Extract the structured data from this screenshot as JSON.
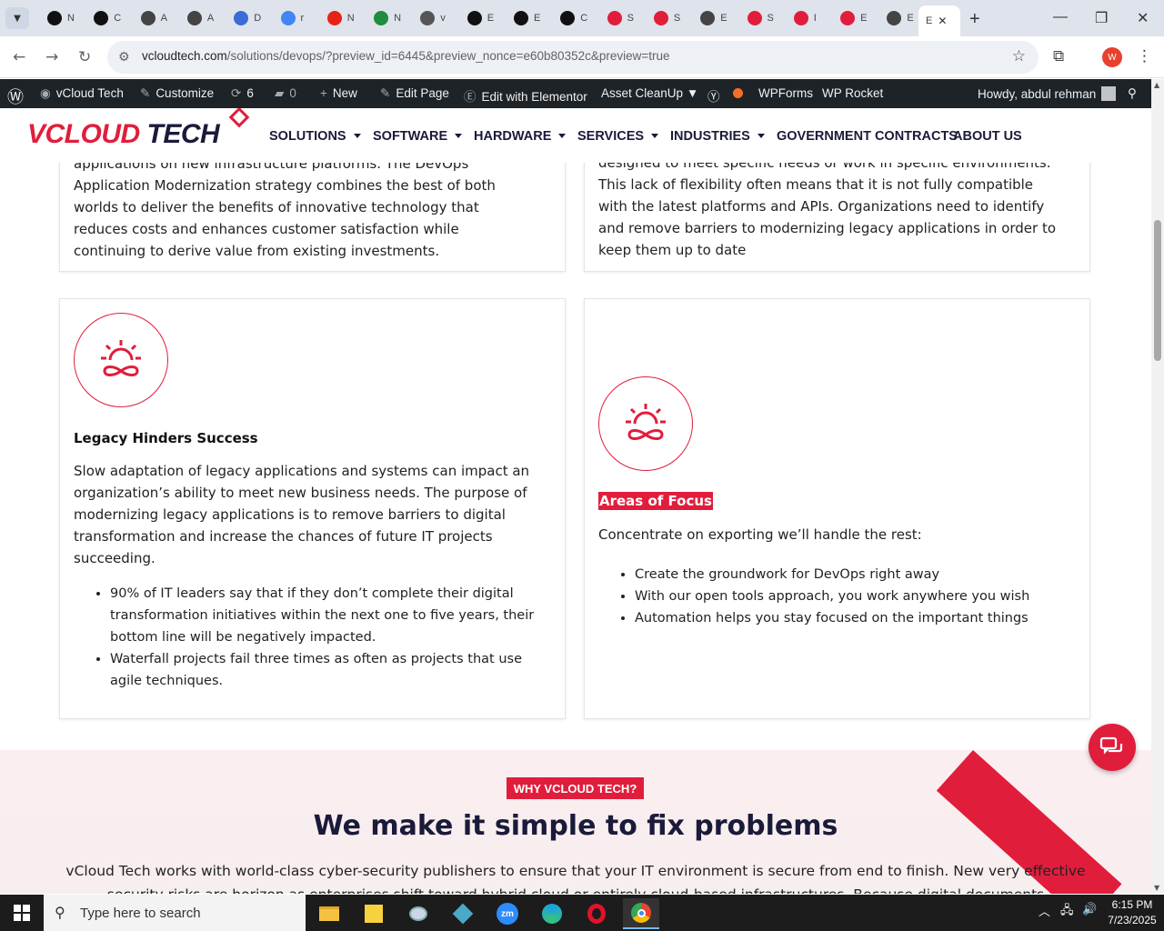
{
  "browser": {
    "tabs": [
      {
        "label": "N",
        "icon": "openai-icon",
        "color": "#111111"
      },
      {
        "label": "C",
        "icon": "openai-icon",
        "color": "#111111"
      },
      {
        "label": "A",
        "icon": "openai-icon",
        "color": "#444444"
      },
      {
        "label": "A",
        "icon": "openai-icon",
        "color": "#444444"
      },
      {
        "label": "D",
        "icon": "dev-icon",
        "color": "#3b6bd6"
      },
      {
        "label": "r",
        "icon": "google-icon",
        "color": "#4285f4"
      },
      {
        "label": "N",
        "icon": "youtube-icon",
        "color": "#e62117"
      },
      {
        "label": "N",
        "icon": "w-icon",
        "color": "#1e8e3e"
      },
      {
        "label": "v",
        "icon": "linkedin-icon",
        "color": "#555555"
      },
      {
        "label": "E",
        "icon": "x-icon",
        "color": "#111111"
      },
      {
        "label": "E",
        "icon": "x-icon",
        "color": "#111111"
      },
      {
        "label": "C",
        "icon": "capcut-icon",
        "color": "#111111"
      },
      {
        "label": "S",
        "icon": "vcloud-icon",
        "color": "#e11d3c"
      },
      {
        "label": "S",
        "icon": "vcloud-icon",
        "color": "#e11d3c"
      },
      {
        "label": "E",
        "icon": "globe-icon",
        "color": "#444444"
      },
      {
        "label": "S",
        "icon": "vcloud-icon",
        "color": "#e11d3c"
      },
      {
        "label": "I",
        "icon": "vcloud-icon",
        "color": "#e11d3c"
      },
      {
        "label": "E",
        "icon": "vcloud-icon",
        "color": "#e11d3c"
      },
      {
        "label": "E",
        "icon": "globe-icon",
        "color": "#444444"
      }
    ],
    "active_tab": {
      "label": "E"
    },
    "url_host": "vcloudtech.com",
    "url_path": "/solutions/devops/?preview_id=6445&preview_nonce=e60b80352c&preview=true",
    "profile_initial": "W"
  },
  "adminbar": {
    "site": "vCloud Tech",
    "customize": "Customize",
    "updates": "6",
    "comments": "0",
    "new": "New",
    "edit_page": "Edit Page",
    "elementor": "Edit with Elementor",
    "asset_cleanup": "Asset CleanUp",
    "wpforms": "WPForms",
    "wprocket": "WP Rocket",
    "howdy": "Howdy, abdul rehman"
  },
  "site": {
    "logo_v": "V",
    "logo_cloud": "CLOUD",
    "logo_tech": " TECH",
    "menu": [
      "SOLUTIONS",
      "SOFTWARE",
      "HARDWARE",
      "SERVICES",
      "INDUSTRIES",
      "GOVERNMENT CONTRACTS",
      "ABOUT US"
    ]
  },
  "cards": {
    "top_left_lines": [
      "applications on new infrastructure platforms. The DevOps",
      "Application Modernization strategy combines the best of both",
      "worlds to deliver the benefits of innovative technology that",
      "reduces costs and enhances customer satisfaction while",
      "continuing to derive value from existing investments."
    ],
    "top_right_lines": [
      "designed to meet specific needs or work in specific environments.",
      "This lack of flexibility often means that it is not fully compatible",
      "with the latest platforms and APIs. Organizations need to identify",
      "and remove barriers to modernizing legacy applications in order to",
      "keep them up to date"
    ],
    "legacy": {
      "title": "Legacy Hinders Success",
      "para": "Slow adaptation of legacy applications and systems can impact an organization’s ability to meet new business needs. The purpose of modernizing legacy applications is to remove barriers to digital transformation and increase the chances of future IT projects succeeding.",
      "bullets": [
        "90% of IT leaders say that if they don’t complete their digital transformation initiatives within the next one to five years, their bottom line will be negatively impacted.",
        "Waterfall projects fail three times as often as projects that use agile techniques."
      ]
    },
    "focus": {
      "title": "Areas of Focus",
      "para": "Concentrate on exporting we’ll handle the rest:",
      "bullets": [
        "Create the groundwork for DevOps right away",
        "With our open tools approach, you work anywhere you wish",
        "Automation helps you stay focused on the important things"
      ]
    }
  },
  "why": {
    "badge": "WHY VCLOUD TECH?",
    "heading": "We make it simple to fix problems",
    "para": "vCloud Tech works with world-class cyber-security publishers to ensure that your IT environment is secure from end to finish. New very effective security risks are horizon as enterprises shift toward hybrid cloud or entirely cloud-based infrastructures. Because digital documents"
  },
  "taskbar": {
    "search_placeholder": "Type here to search",
    "time": "6:15 PM",
    "date": "7/23/2025"
  },
  "colors": {
    "brand_red": "#e11d3c",
    "navy": "#1a1a3a",
    "adminbar": "#1d2327"
  }
}
